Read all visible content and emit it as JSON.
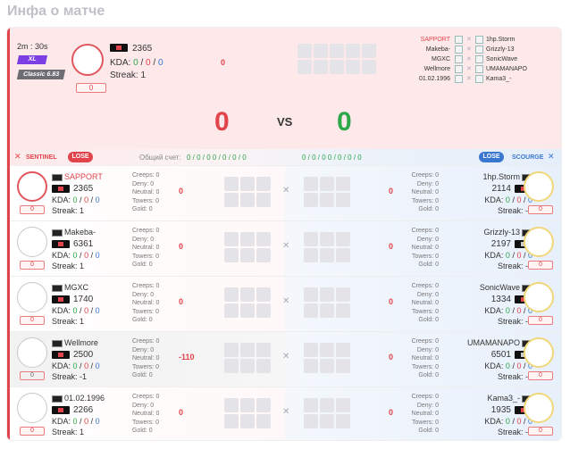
{
  "page_title": "Инфа о матче",
  "match": {
    "time": "2m : 30s",
    "mode_badge": "XL",
    "version_badge": "Classic 6.83",
    "host": {
      "mmr": "2365",
      "kda_k": "0",
      "kda_d": "0",
      "kda_a": "0",
      "streak": "Streak: 1",
      "rank": "0",
      "delta": "0"
    },
    "score_left": "0",
    "vs": "VS",
    "score_right": "0",
    "mini_left": [
      "SAPPORT",
      "Makeba-",
      "MGXC",
      "Wellmore",
      "01.02.1996"
    ],
    "mini_right": [
      "1hp.Storm",
      "Grizzly-13",
      "SonicWave",
      "UMAMANAPO",
      "Kama3_-"
    ]
  },
  "header": {
    "sentinel": "SENTINEL",
    "lose_left": "LOSE",
    "general_score_label": "Общий счет:",
    "score_left": "0 / 0 / 0    0 / 0 / 0 / 0",
    "score_right": "0 / 0 / 0    0 / 0 / 0 / 0",
    "lose_right": "LOSE",
    "scourge": "SCOURGE"
  },
  "labels": {
    "kda": "KDA:",
    "creeps": "Creeps:",
    "deny": "Deny:",
    "neutral": "Neutral:",
    "towers": "Towers:",
    "gold": "Gold:",
    "slash": "/"
  },
  "rows": [
    {
      "left": {
        "name": "SAPPORT",
        "mmr": "2365",
        "k": "0",
        "d": "0",
        "a": "0",
        "streak": "Streak: 1",
        "rank": "0",
        "creeps": "0",
        "deny": "0",
        "neutral": "0",
        "towers": "0",
        "gold": "0",
        "delta": "0"
      },
      "right": {
        "name": "1hp.Storm",
        "mmr": "2114",
        "k": "0",
        "d": "0",
        "a": "0",
        "streak": "Streak: -1",
        "rank": "0",
        "creeps": "0",
        "deny": "0",
        "neutral": "0",
        "towers": "0",
        "gold": "0",
        "delta": "0"
      }
    },
    {
      "left": {
        "name": "Makeba-",
        "mmr": "6361",
        "k": "0",
        "d": "0",
        "a": "0",
        "streak": "Streak: 1",
        "rank": "0",
        "creeps": "0",
        "deny": "0",
        "neutral": "0",
        "towers": "0",
        "gold": "0",
        "delta": "0"
      },
      "right": {
        "name": "Grizzly-13",
        "mmr": "2197",
        "k": "0",
        "d": "0",
        "a": "0",
        "streak": "Streak: -1",
        "rank": "0",
        "creeps": "0",
        "deny": "0",
        "neutral": "0",
        "towers": "0",
        "gold": "0",
        "delta": "0"
      }
    },
    {
      "left": {
        "name": "MGXC",
        "mmr": "1740",
        "k": "0",
        "d": "0",
        "a": "0",
        "streak": "Streak: 1",
        "rank": "0",
        "creeps": "0",
        "deny": "0",
        "neutral": "0",
        "towers": "0",
        "gold": "0",
        "delta": "0"
      },
      "right": {
        "name": "SonicWave",
        "mmr": "1334",
        "k": "0",
        "d": "0",
        "a": "0",
        "streak": "Streak: -3",
        "rank": "0",
        "creeps": "0",
        "deny": "0",
        "neutral": "0",
        "towers": "0",
        "gold": "0",
        "delta": "0"
      }
    },
    {
      "left": {
        "name": "Wellmore",
        "mmr": "2500",
        "k": "0",
        "d": "0",
        "a": "0",
        "streak": "Streak: -1",
        "rank": "0",
        "creeps": "0",
        "deny": "0",
        "neutral": "0",
        "towers": "0",
        "gold": "0",
        "delta": "-110"
      },
      "right": {
        "name": "UMAMANAPO",
        "mmr": "6501",
        "k": "0",
        "d": "0",
        "a": "0",
        "streak": "Streak: -5",
        "rank": "0",
        "creeps": "0",
        "deny": "0",
        "neutral": "0",
        "towers": "0",
        "gold": "0",
        "delta": "0"
      }
    },
    {
      "left": {
        "name": "01.02.1996",
        "mmr": "2266",
        "k": "0",
        "d": "0",
        "a": "0",
        "streak": "Streak: 1",
        "rank": "0",
        "creeps": "0",
        "deny": "0",
        "neutral": "0",
        "towers": "0",
        "gold": "0",
        "delta": "0"
      },
      "right": {
        "name": "Kama3_-",
        "mmr": "1935",
        "k": "0",
        "d": "0",
        "a": "0",
        "streak": "Streak: -1",
        "rank": "0",
        "creeps": "0",
        "deny": "0",
        "neutral": "0",
        "towers": "0",
        "gold": "0",
        "delta": "0"
      }
    }
  ],
  "colors": {
    "accent_red": "#e2444c",
    "green": "#2da84a",
    "blue": "#3a78d0",
    "lose_red": "#e2444c",
    "lose_blue": "#3a78d0"
  }
}
